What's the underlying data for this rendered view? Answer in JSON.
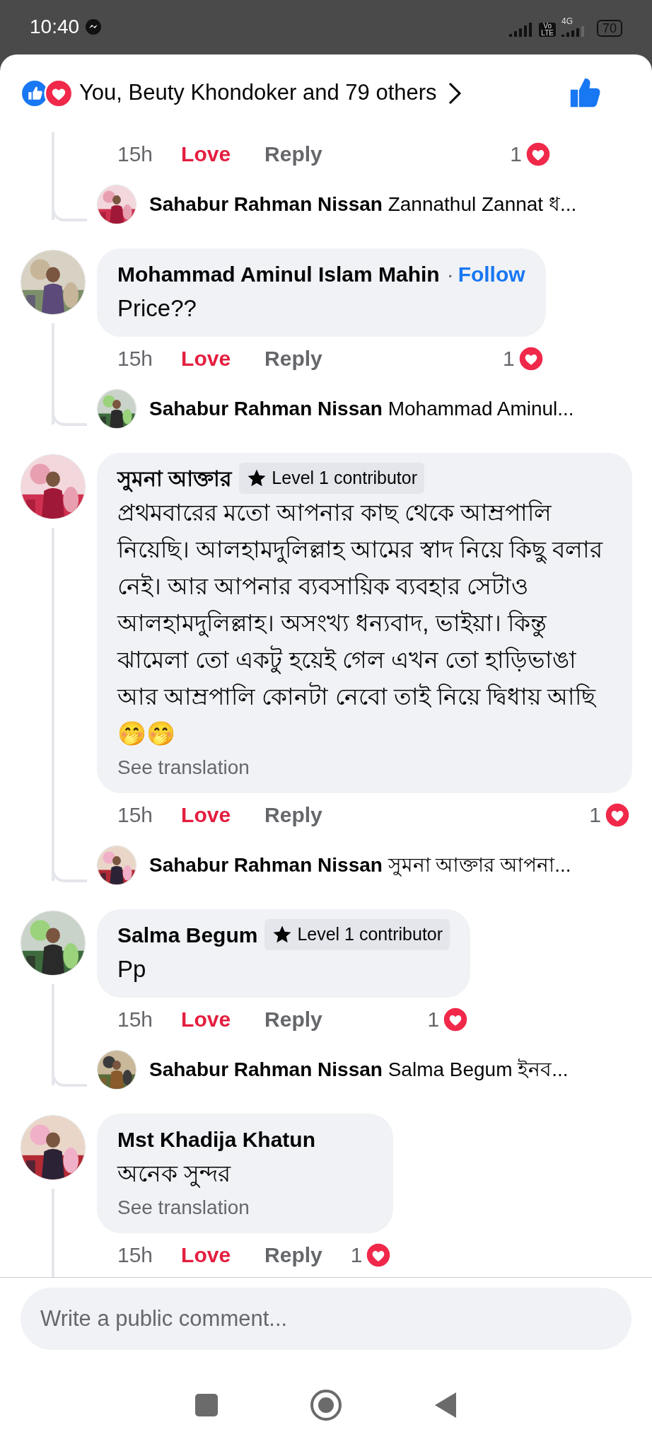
{
  "status_bar": {
    "time": "10:40",
    "volte_top": "Vo",
    "volte_bottom": "LTE",
    "network": "4G",
    "battery": "70"
  },
  "reactions_summary": {
    "text": "You, Beuty Khondoker and 79 others",
    "liked": true
  },
  "comments": [
    {
      "time": "15h",
      "love_label": "Love",
      "loved": true,
      "reply_label": "Reply",
      "reaction_count": "1",
      "reply": {
        "author": "Sahabur Rahman Nissan",
        "text": "Zannathul Zannat ধ..."
      }
    },
    {
      "author": "Mohammad Aminul Islam Mahin",
      "follow_separator": "·",
      "follow": "Follow",
      "text": "Price??",
      "time": "15h",
      "love_label": "Love",
      "loved": true,
      "reply_label": "Reply",
      "reaction_count": "1",
      "reply": {
        "author": "Sahabur Rahman Nissan",
        "text": "Mohammad Aminul..."
      }
    },
    {
      "author": "সুমনা আক্তার",
      "badge": "Level 1 contributor",
      "text": "প্রথমবারের মতো আপনার কাছ থেকে আম্রপালি নিয়েছি। আলহামদুলিল্লাহ আমের স্বাদ নিয়ে কিছু বলার নেই। আর আপনার ব্যবসায়িক ব্যবহার সেটাও আলহামদুলিল্লাহ। অসংখ্য ধন্যবাদ, ভাইয়া। কিন্তু ঝামেলা তো একটু হয়েই গেল এখন তো হাড়িভাঙা আর আম্রপালি কোনটা নেবো তাই নিয়ে দ্বিধায় আছি🤭🤭",
      "see_translation": "See translation",
      "time": "15h",
      "love_label": "Love",
      "loved": true,
      "reply_label": "Reply",
      "reaction_count": "1",
      "reply": {
        "author": "Sahabur Rahman Nissan",
        "text": "সুমনা আক্তার আপনা..."
      }
    },
    {
      "author": "Salma Begum",
      "badge": "Level 1 contributor",
      "text": "Pp",
      "time": "15h",
      "love_label": "Love",
      "loved": true,
      "reply_label": "Reply",
      "reaction_count": "1",
      "reply": {
        "author": "Sahabur Rahman Nissan",
        "text": "Salma Begum ইনব..."
      }
    },
    {
      "author": "Mst Khadija Khatun",
      "text": "অনেক সুন্দর",
      "see_translation": "See translation",
      "time": "15h",
      "love_label": "Love",
      "loved": true,
      "reply_label": "Reply",
      "reaction_count": "1"
    }
  ],
  "comment_box": {
    "placeholder": "Write a public comment..."
  }
}
